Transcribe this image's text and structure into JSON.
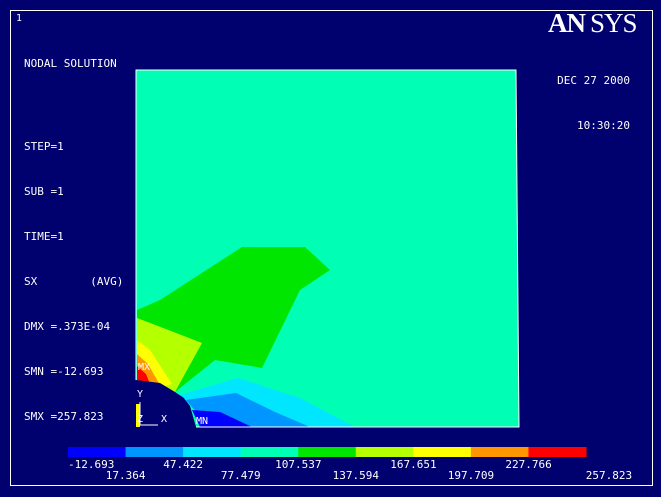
{
  "window_number": "1",
  "logo": "ANSYS",
  "header": {
    "title": "NODAL SOLUTION",
    "lines": [
      "STEP=1",
      "SUB =1",
      "TIME=1",
      "SX        (AVG)",
      "DMX =.373E-04",
      "SMN =-12.693",
      "SMX =257.823"
    ]
  },
  "date": "DEC 27 2000",
  "time": "10:30:20",
  "labels": {
    "mx": "MX",
    "mn": "MN",
    "axis_y": "Y",
    "axis_z": "Z",
    "axis_x": "X"
  },
  "colors": {
    "background": "#00006e",
    "bands": [
      "#0000ff",
      "#0096ff",
      "#00e6ff",
      "#00ffb4",
      "#00e600",
      "#b4ff00",
      "#ffff00",
      "#ff9600",
      "#ff0000"
    ]
  },
  "legend": {
    "values": [
      "-12.693",
      "17.364",
      "47.422",
      "77.479",
      "107.537",
      "137.594",
      "167.651",
      "197.709",
      "227.766",
      "257.823"
    ]
  }
}
